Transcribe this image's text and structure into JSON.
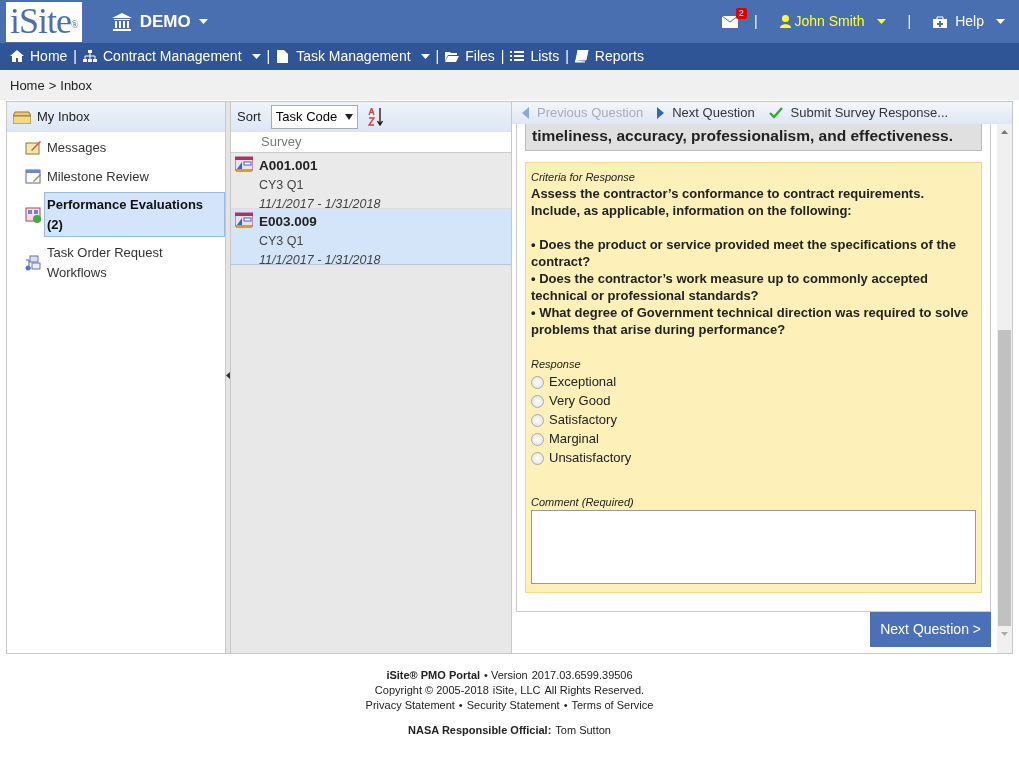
{
  "header": {
    "logo": "iSite",
    "logo_mark": "®",
    "site": "DEMO",
    "mail_count": "2",
    "user": "John Smith",
    "help": "Help",
    "separators": [
      "|",
      "|"
    ]
  },
  "nav": [
    {
      "label": "Home",
      "caret": false,
      "separator": "|"
    },
    {
      "label": "Contract Management",
      "caret": true,
      "separator": "|"
    },
    {
      "label": "Task Management",
      "caret": true,
      "separator": "|"
    },
    {
      "label": "Files",
      "caret": false,
      "separator": "|"
    },
    {
      "label": "Lists",
      "caret": false,
      "separator": "|"
    },
    {
      "label": "Reports",
      "caret": false
    }
  ],
  "breadcrumb": {
    "link": "Home",
    "separator": ">",
    "current": "Inbox"
  },
  "sidebar": {
    "title": "My Inbox",
    "items": [
      {
        "label": "Messages",
        "selected": false
      },
      {
        "label": "Milestone Review",
        "selected": false
      },
      {
        "label": "Performance Evaluations (2)",
        "selected": true
      },
      {
        "label": "Task Order Request Workflows",
        "selected": false
      }
    ]
  },
  "list": {
    "sort_label": "Sort",
    "sort_value": "Task Code",
    "column": "Survey",
    "items": [
      {
        "code": "A001.001",
        "period": "CY3 Q1",
        "dates": "11/1/2017 - 1/31/2018",
        "selected": false
      },
      {
        "code": "E003.009",
        "period": "CY3 Q1",
        "dates": "11/1/2017 - 1/31/2018",
        "selected": true
      }
    ]
  },
  "toolbar": [
    {
      "kind": "prev",
      "label": "Previous Question",
      "disabled": true
    },
    {
      "kind": "next",
      "label": "Next Question",
      "disabled": false
    },
    {
      "kind": "submit",
      "label": "Submit Survey Response...",
      "disabled": false
    }
  ],
  "question": {
    "text": "timeliness, accuracy, professionalism, and effectiveness.",
    "criteria_label": "Criteria for Response",
    "criteria_intro": "Assess the contractor’s conformance to contract requirements. Include, as applicable, information on the following:",
    "criteria": [
      "• Does the product or service provided meet the specifications of the contract?",
      "• Does the contractor’s work measure up to commonly accepted technical or professional standards?",
      "• What degree of Government technical direction was required to solve problems that arise during performance?"
    ],
    "response_label": "Response",
    "options": [
      {
        "label": "Exceptional",
        "checked": false
      },
      {
        "label": "Very Good",
        "checked": false
      },
      {
        "label": "Satisfactory",
        "checked": false
      },
      {
        "label": "Marginal",
        "checked": false
      },
      {
        "label": "Unsatisfactory",
        "checked": false
      }
    ],
    "comment_label": "Comment (Required)"
  },
  "next_button": "Next Question >",
  "footer": [
    [
      {
        "kind": "bold",
        "text": "iSite® PMO Portal"
      },
      {
        "kind": "text",
        "text": "• Version"
      },
      {
        "kind": "link",
        "text": "2017.03.6599.39506"
      }
    ],
    [
      {
        "kind": "text",
        "text": "Copyright © 2005-2018"
      },
      {
        "kind": "link",
        "text": "iSite, LLC"
      },
      {
        "kind": "text",
        "text": "All Rights Reserved."
      }
    ],
    [
      {
        "kind": "link",
        "text": "Privacy Statement"
      },
      {
        "kind": "text",
        "text": "•"
      },
      {
        "kind": "link",
        "text": "Security Statement"
      },
      {
        "kind": "text",
        "text": "•"
      },
      {
        "kind": "link",
        "text": "Terms of Service"
      }
    ],
    [
      {
        "kind": "bold",
        "text": "NASA Responsible Official:"
      },
      {
        "kind": "link",
        "text": "Tom Sutton"
      }
    ]
  ]
}
